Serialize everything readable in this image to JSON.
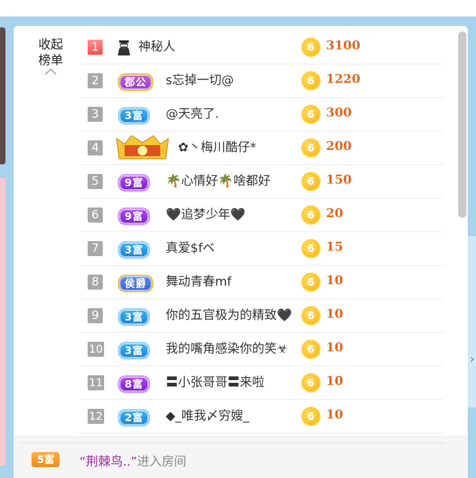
{
  "panel": {
    "collapse_label": "收起榜单"
  },
  "ranking": [
    {
      "rank": "1",
      "avatar_icon": "ninja-avatar-icon",
      "badge": "",
      "badge_style": "",
      "name": "神秘人",
      "amount": "3100"
    },
    {
      "rank": "2",
      "avatar_icon": "",
      "badge": "郡公",
      "badge_style": "gold",
      "name": "s忘掉一切@",
      "amount": "1220"
    },
    {
      "rank": "3",
      "avatar_icon": "",
      "badge": "3富",
      "badge_style": "blue",
      "name": "@天亮了.",
      "amount": "300"
    },
    {
      "rank": "4",
      "avatar_icon": "crown-icon",
      "badge": "",
      "badge_style": "",
      "name": "✿丶梅川酷仔*",
      "amount": "200"
    },
    {
      "rank": "5",
      "avatar_icon": "",
      "badge": "9富",
      "badge_style": "purple",
      "name": "🌴心情好🌴啥都好",
      "amount": "150"
    },
    {
      "rank": "6",
      "avatar_icon": "",
      "badge": "9富",
      "badge_style": "purple",
      "name": "🖤追梦少年🖤",
      "amount": "20"
    },
    {
      "rank": "7",
      "avatar_icon": "",
      "badge": "3富",
      "badge_style": "blue",
      "name": "真爱$fベ",
      "amount": "15"
    },
    {
      "rank": "8",
      "avatar_icon": "",
      "badge": "侯爵",
      "badge_style": "blue2",
      "name": "舞动青春mf",
      "amount": "10"
    },
    {
      "rank": "9",
      "avatar_icon": "",
      "badge": "3富",
      "badge_style": "blue",
      "name": "你的五官极为的精致🖤",
      "amount": "10"
    },
    {
      "rank": "10",
      "avatar_icon": "",
      "badge": "3富",
      "badge_style": "blue",
      "name": "我的嘴角感染你的笑☣",
      "amount": "10"
    },
    {
      "rank": "11",
      "avatar_icon": "",
      "badge": "8富",
      "badge_style": "purple",
      "name": "〓小张哥哥〓来啦",
      "amount": "10"
    },
    {
      "rank": "12",
      "avatar_icon": "",
      "badge": "2富",
      "badge_style": "blue",
      "name": "◆_唯我〆穷嫂_",
      "amount": "10"
    }
  ],
  "coin_symbol": "6",
  "footer": {
    "badge": "5富",
    "user": "“荆棘鸟..”",
    "action": "进入房间"
  }
}
